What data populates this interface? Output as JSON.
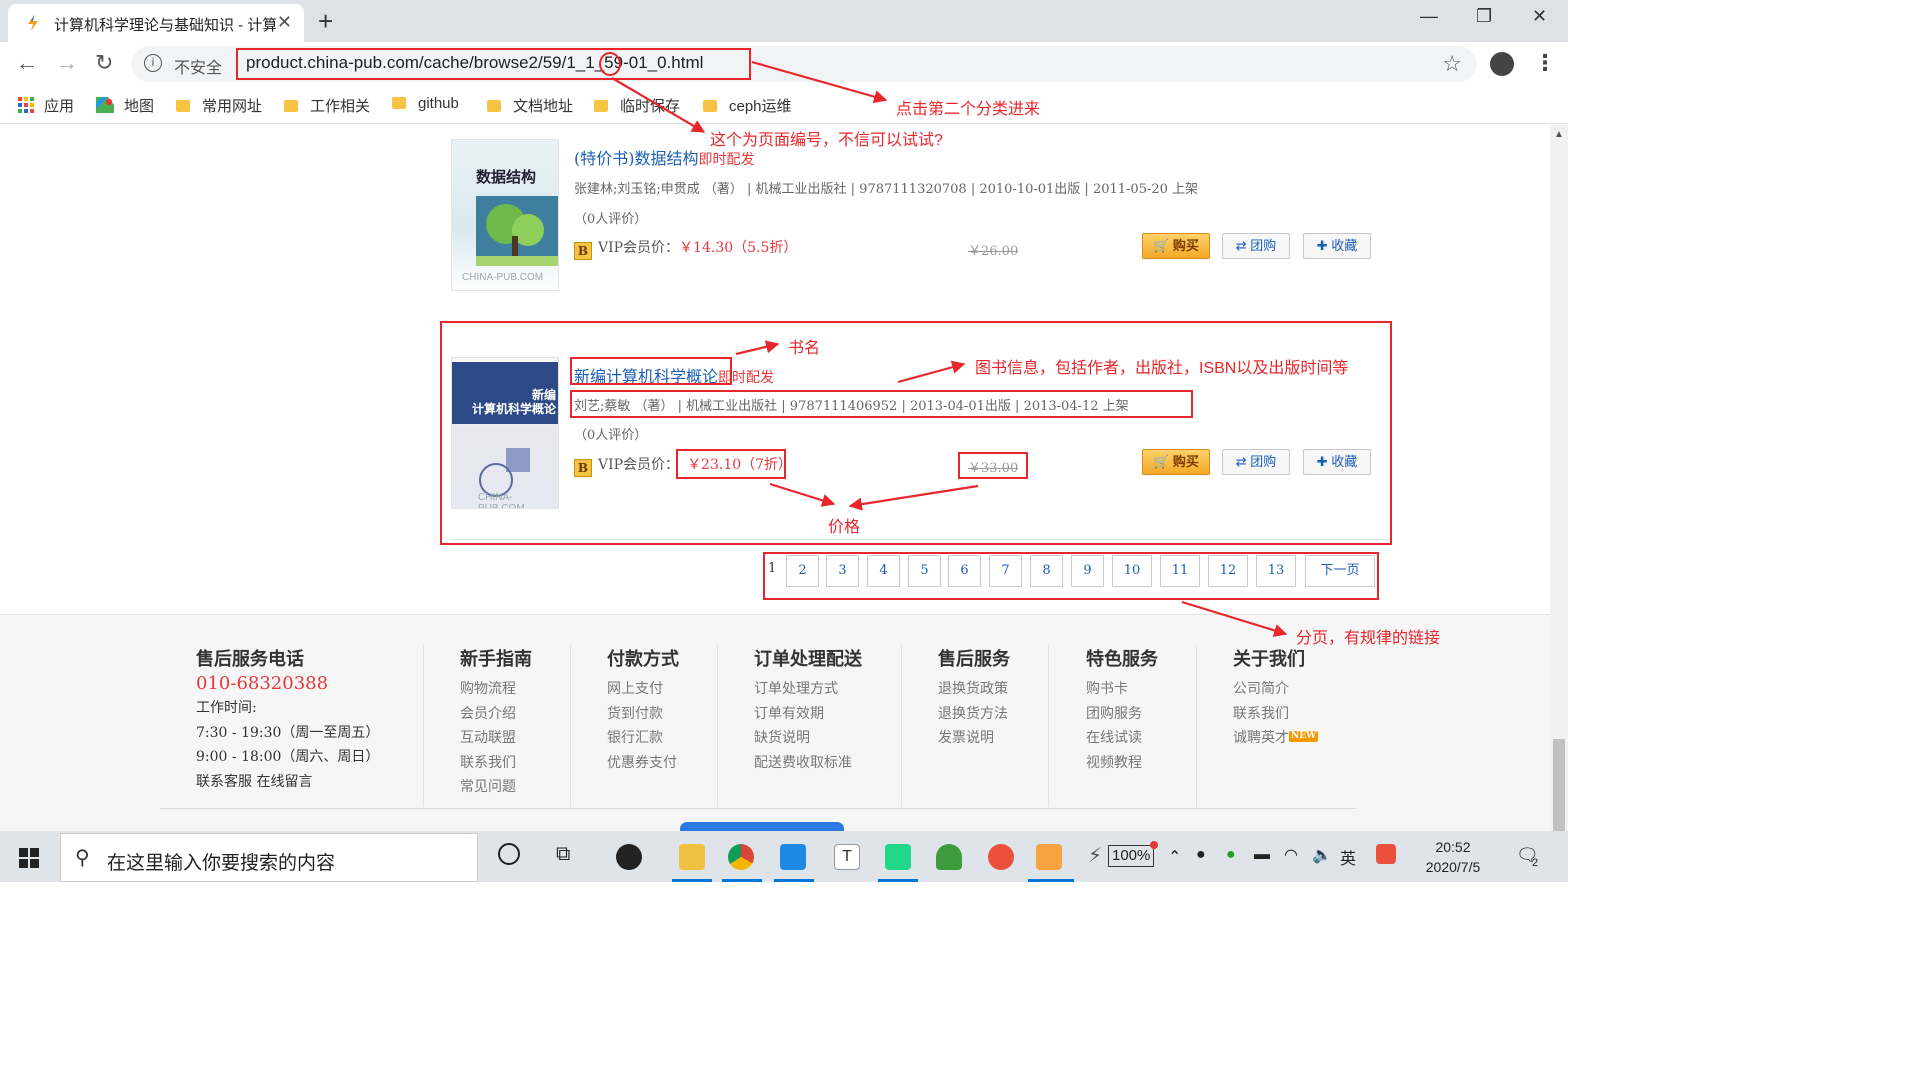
{
  "browser": {
    "tab_title": "计算机科学理论与基础知识 - 计算",
    "security_label": "不安全",
    "url": "product.china-pub.com/cache/browse2/59/1_1_59-01_0.html"
  },
  "bookmarks": [
    "应用",
    "地图",
    "常用网址",
    "工作相关",
    "github",
    "文档地址",
    "临时保存",
    "ceph运维"
  ],
  "books": [
    {
      "cover_text": "数据结构",
      "cover_sub": "CHINA-PUB.COM",
      "title": "(特价书)数据结构",
      "tag": "即时配发",
      "meta": "张建林;刘玉铭;申贯成 （著） | 机械工业出版社 | 9787111320708 | 2010-10-01出版 | 2011-05-20 上架",
      "rating": "（0人评价）",
      "vip_label": "VIP会员价：",
      "vip_price": "￥14.30（5.5折）",
      "orig_price": "￥26.00"
    },
    {
      "cover_text": "新编\n计算机科学概论",
      "cover_sub": "CHINA-PUB.COM",
      "title": "新编计算机科学概论",
      "tag": "即时配发",
      "meta": "刘艺;蔡敏 （著） | 机械工业出版社 | 9787111406952 | 2013-04-01出版 | 2013-04-12 上架",
      "rating": "（0人评价）",
      "vip_label": "VIP会员价：",
      "vip_price": "￥23.10（7折）",
      "orig_price": "￥33.00"
    }
  ],
  "actions": {
    "buy": "购买",
    "group": "团购",
    "fav": "收藏"
  },
  "pagination": [
    "1",
    "2",
    "3",
    "4",
    "5",
    "6",
    "7",
    "8",
    "9",
    "10",
    "11",
    "12",
    "13",
    "下一页"
  ],
  "annotations": {
    "next_category": "点击第二个分类进来",
    "page_number": "这个为页面编号，不信可以试试?",
    "book_name": "书名",
    "book_info": "图书信息，包括作者，出版社，ISBN以及出版时间等",
    "price": "价格",
    "paging": "分页，有规律的链接"
  },
  "footer": [
    {
      "title": "售后服务电话",
      "phone": "010-68320388",
      "items": [
        "工作时间:",
        "7:30 - 19:30（周一至周五）",
        "9:00 - 18:00（周六、周日）",
        "联系客服  在线留言"
      ]
    },
    {
      "title": "新手指南",
      "items": [
        "购物流程",
        "会员介绍",
        "互动联盟",
        "联系我们",
        "常见问题"
      ]
    },
    {
      "title": "付款方式",
      "items": [
        "网上支付",
        "货到付款",
        "银行汇款",
        "优惠券支付"
      ]
    },
    {
      "title": "订单处理配送",
      "items": [
        "订单处理方式",
        "订单有效期",
        "缺货说明",
        "配送费收取标准"
      ]
    },
    {
      "title": "售后服务",
      "items": [
        "退换货政策",
        "退换货方法",
        "发票说明"
      ]
    },
    {
      "title": "特色服务",
      "items": [
        "购书卡",
        "团购服务",
        "在线试读",
        "视频教程"
      ]
    },
    {
      "title": "关于我们",
      "items": [
        "公司简介",
        "联系我们",
        "诚聘英才"
      ],
      "badge": "NEW"
    }
  ],
  "taskbar": {
    "search_placeholder": "在这里输入你要搜索的内容",
    "battery": "100%",
    "time": "20:52",
    "date": "2020/7/5",
    "notifications": "2"
  },
  "colors": {
    "accent_red": "#e8262c",
    "link_blue": "#1a5fb4",
    "price_red": "#e4393c"
  }
}
